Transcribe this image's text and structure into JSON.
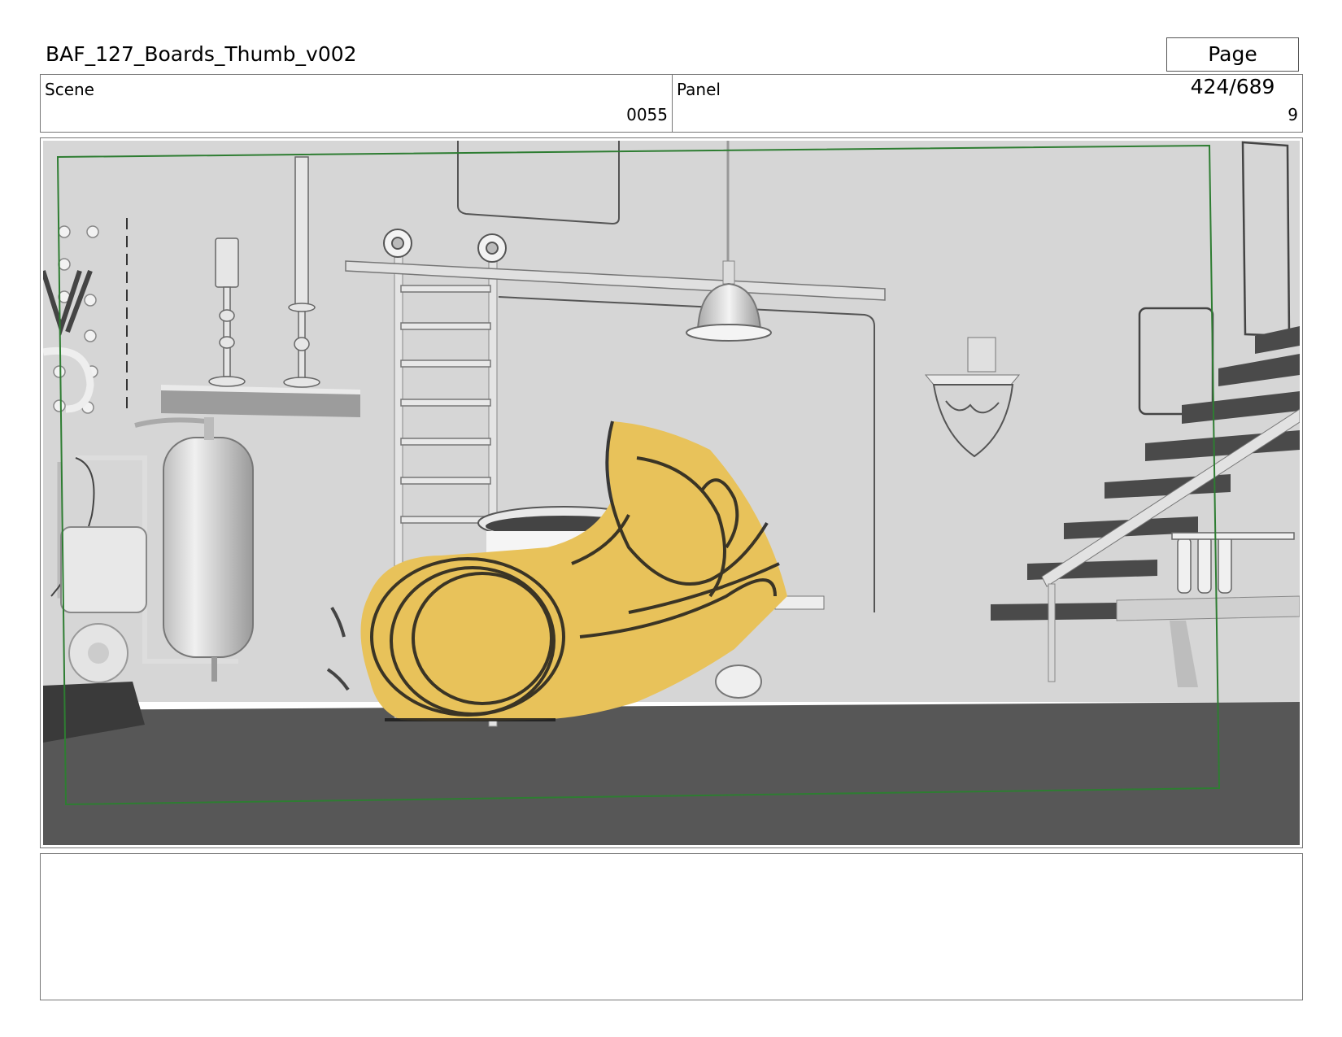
{
  "header": {
    "title": "BAF_127_Boards_Thumb_v002",
    "page": "Page 424/689"
  },
  "scene": {
    "label": "Scene",
    "value": "0055"
  },
  "panel": {
    "label": "Panel",
    "value": "9"
  },
  "colors": {
    "wall": "#d6d6d6",
    "floor": "#575757",
    "character": "#e8c25a",
    "safe_frame": "#2e7d32"
  },
  "notes": ""
}
